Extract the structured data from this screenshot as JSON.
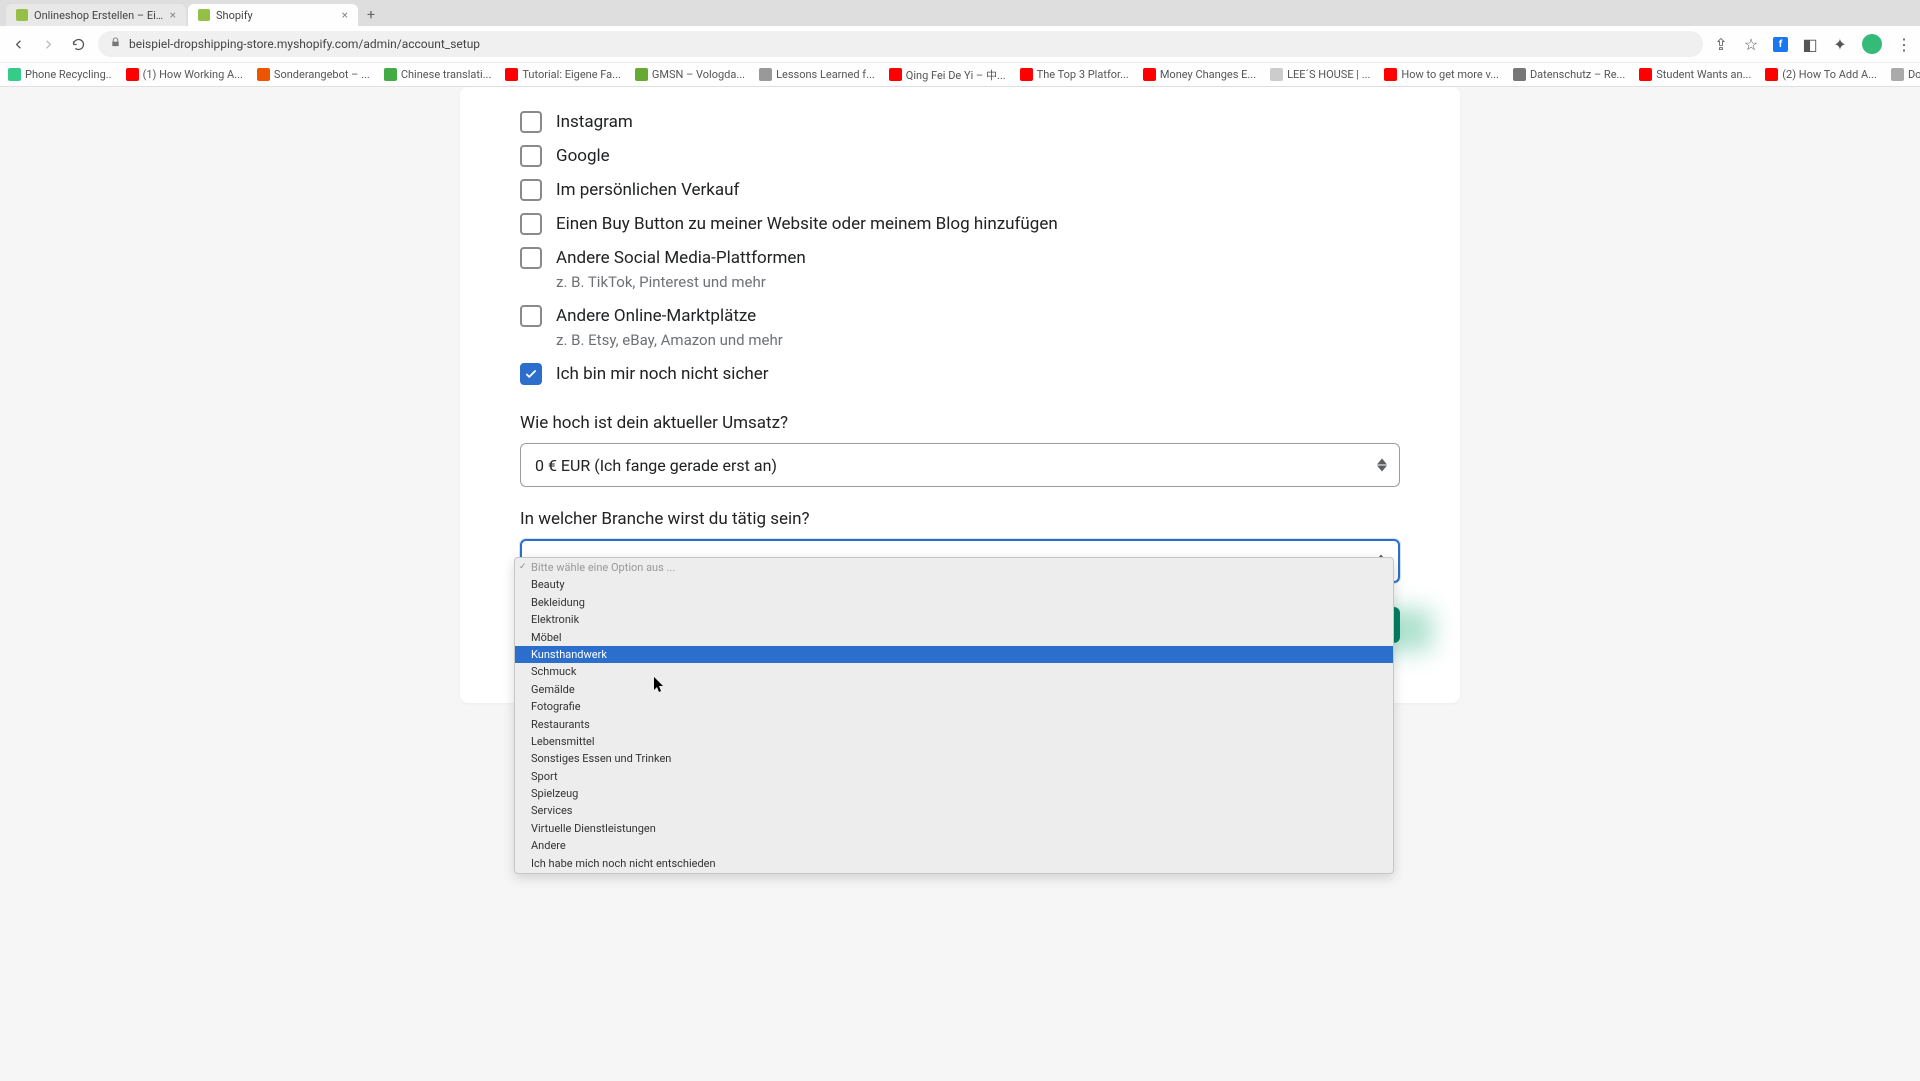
{
  "browser": {
    "tabs": [
      {
        "title": "Onlineshop Erstellen – Einfac",
        "active": false
      },
      {
        "title": "Shopify",
        "active": true
      }
    ],
    "url": "beispiel-dropshipping-store.myshopify.com/admin/account_setup",
    "bookmarks": [
      {
        "label": "Phone Recycling..",
        "color": "#3c8"
      },
      {
        "label": "(1) How Working A...",
        "color": "#f00"
      },
      {
        "label": "Sonderangebot – ...",
        "color": "#e50"
      },
      {
        "label": "Chinese translati...",
        "color": "#4a4"
      },
      {
        "label": "Tutorial: Eigene Fa...",
        "color": "#f00"
      },
      {
        "label": "GMSN – Vologda...",
        "color": "#6a3"
      },
      {
        "label": "Lessons Learned f...",
        "color": "#999"
      },
      {
        "label": "Qing Fei De Yi – 中...",
        "color": "#f00"
      },
      {
        "label": "The Top 3 Platfor...",
        "color": "#f00"
      },
      {
        "label": "Money Changes E...",
        "color": "#f00"
      },
      {
        "label": "LEE´S HOUSE | ...",
        "color": "#ccc"
      },
      {
        "label": "How to get more v...",
        "color": "#f00"
      },
      {
        "label": "Datenschutz – Re...",
        "color": "#777"
      },
      {
        "label": "Student Wants an...",
        "color": "#f00"
      },
      {
        "label": "(2) How To Add A...",
        "color": "#f00"
      },
      {
        "label": "Download – Cooki...",
        "color": "#aaa"
      }
    ]
  },
  "form": {
    "checkboxes": [
      {
        "label": "Instagram",
        "checked": false
      },
      {
        "label": "Google",
        "checked": false
      },
      {
        "label": "Im persönlichen Verkauf",
        "checked": false
      },
      {
        "label": "Einen Buy Button zu meiner Website oder meinem Blog hinzufügen",
        "checked": false
      },
      {
        "label": "Andere Social Media-Plattformen",
        "checked": false,
        "sub": "z. B. TikTok, Pinterest und mehr"
      },
      {
        "label": "Andere Online-Marktplätze",
        "checked": false,
        "sub": "z. B. Etsy, eBay, Amazon und mehr"
      },
      {
        "label": "Ich bin mir noch nicht sicher",
        "checked": true
      }
    ],
    "revenue_label": "Wie hoch ist dein aktueller Umsatz?",
    "revenue_value": "0 € EUR (Ich fange gerade erst an)",
    "industry_label": "In welcher Branche wirst du tätig sein?",
    "industry_placeholder": "Bitte wähle eine Option aus ...",
    "industry_options": [
      "Beauty",
      "Bekleidung",
      "Elektronik",
      "Möbel",
      "Kunsthandwerk",
      "Schmuck",
      "Gemälde",
      "Fotografie",
      "Restaurants",
      "Lebensmittel",
      "Sonstiges Essen und Trinken",
      "Sport",
      "Spielzeug",
      "Services",
      "Virtuelle Dienstleistungen",
      "Andere",
      "Ich habe mich noch nicht entschieden"
    ],
    "industry_highlighted_index": 4
  }
}
